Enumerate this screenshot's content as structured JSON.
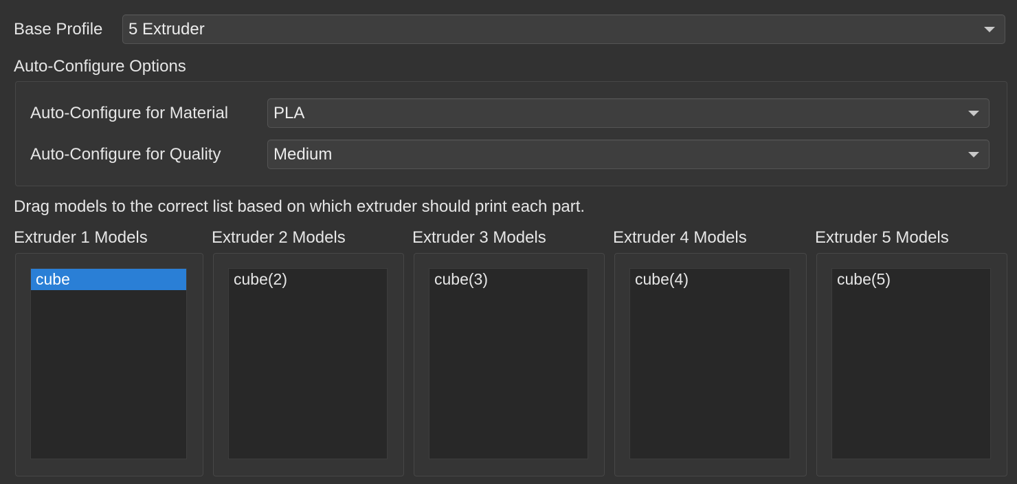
{
  "base_profile": {
    "label": "Base Profile",
    "selected": "5 Extruder"
  },
  "auto_configure": {
    "heading": "Auto-Configure Options",
    "material_label": "Auto-Configure for Material",
    "material_selected": "PLA",
    "quality_label": "Auto-Configure for Quality",
    "quality_selected": "Medium"
  },
  "instructions": "Drag models to the correct list based on which extruder should print each part.",
  "extruders": [
    {
      "title": "Extruder 1 Models",
      "models": [
        {
          "name": "cube",
          "selected": true
        }
      ]
    },
    {
      "title": "Extruder 2 Models",
      "models": [
        {
          "name": "cube(2)",
          "selected": false
        }
      ]
    },
    {
      "title": "Extruder 3 Models",
      "models": [
        {
          "name": "cube(3)",
          "selected": false
        }
      ]
    },
    {
      "title": "Extruder 4 Models",
      "models": [
        {
          "name": "cube(4)",
          "selected": false
        }
      ]
    },
    {
      "title": "Extruder 5 Models",
      "models": [
        {
          "name": "cube(5)",
          "selected": false
        }
      ]
    }
  ],
  "colors": {
    "background": "#323232",
    "selection": "#2a7fd6"
  }
}
